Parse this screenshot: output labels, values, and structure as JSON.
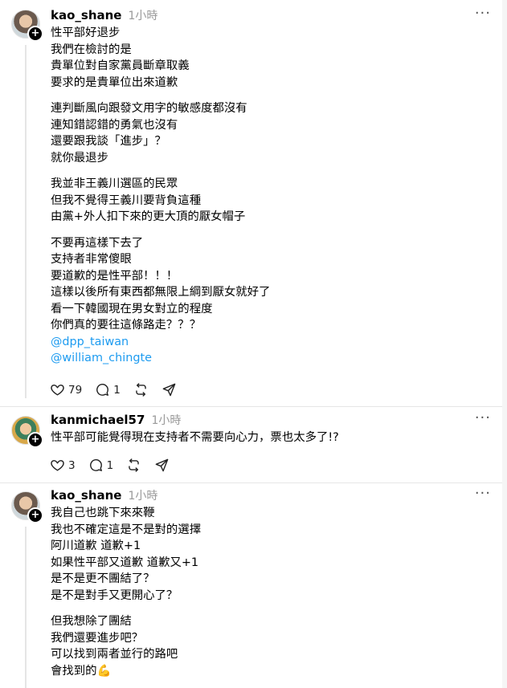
{
  "posts": [
    {
      "username": "kao_shane",
      "time": "1小時",
      "more": "···",
      "lines": [
        "性平部好退步",
        "我們在檢討的是",
        "貴單位對自家黨員斷章取義",
        "要求的是貴單位出來道歉",
        "連判斷風向跟發文用字的敏感度都沒有",
        "連知錯認錯的勇氣也沒有",
        "還要跟我談「進步」？",
        "就你最退步",
        "我並非王義川選區的民眾",
        "但我不覺得王義川要背負這種",
        "由黨+外人扣下來的更大頂的厭女帽子",
        "不要再這樣下去了",
        "支持者非常傻眼",
        "要道歉的是性平部！！！",
        "這樣以後所有東西都無限上綱到厭女就好了",
        "看一下韓國現在男女對立的程度",
        "你們真的要往這條路走？？？",
        "@dpp_taiwan",
        "@william_chingte"
      ],
      "likes": "79",
      "replies": "1"
    },
    {
      "username": "kanmichael57",
      "time": "1小時",
      "more": "···",
      "lines": [
        "性平部可能覺得現在支持者不需要向心力，票也太多了!?"
      ],
      "likes": "3",
      "replies": "1"
    },
    {
      "username": "kao_shane",
      "time": "1小時",
      "more": "···",
      "lines": [
        "我自己也跳下來來鞭",
        "我也不確定這是不是對的選擇",
        "阿川道歉 道歉+1",
        "如果性平部又道歉 道歉又+1",
        "是不是更不團結了？",
        "是不是對手又更開心了？",
        "但我想除了團結",
        "我們還要進步吧？",
        "可以找到兩者並行的路吧",
        "會找到的💪"
      ]
    }
  ],
  "icons": {
    "like": "heart-icon",
    "reply": "comment-icon",
    "repost": "repost-icon",
    "share": "send-icon",
    "follow": "plus-icon",
    "more": "more-icon"
  },
  "colors": {
    "mention": "#1d9bf0",
    "time": "#999999",
    "divider": "#e6e6e6"
  }
}
